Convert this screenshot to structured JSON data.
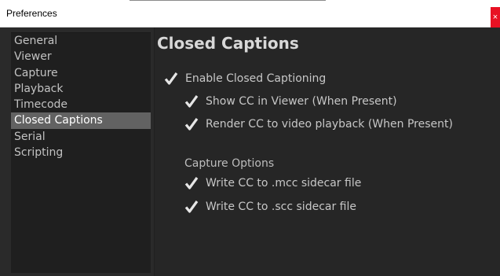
{
  "window": {
    "title": "Preferences",
    "close_glyph": "×"
  },
  "sidebar": {
    "items": [
      {
        "label": "General"
      },
      {
        "label": "Viewer"
      },
      {
        "label": "Capture"
      },
      {
        "label": "Playback"
      },
      {
        "label": "Timecode"
      },
      {
        "label": "Closed Captions",
        "selected": true
      },
      {
        "label": "Serial"
      },
      {
        "label": "Scripting"
      }
    ]
  },
  "main": {
    "heading": "Closed Captions",
    "enable": {
      "label": "Enable Closed Captioning",
      "checked": true
    },
    "show_cc": {
      "label": "Show CC in Viewer (When Present)",
      "checked": true
    },
    "render_cc": {
      "label": "Render CC to video playback (When Present)",
      "checked": true
    },
    "capture_options_label": "Capture Options",
    "write_mcc": {
      "label": "Write CC to .mcc sidecar file",
      "checked": true
    },
    "write_scc": {
      "label": "Write CC to .scc sidecar file",
      "checked": true
    }
  },
  "colors": {
    "background": "#262626",
    "selected_item": "#626262",
    "close_button": "#e81123",
    "checkmark": "#e6e6e6"
  }
}
